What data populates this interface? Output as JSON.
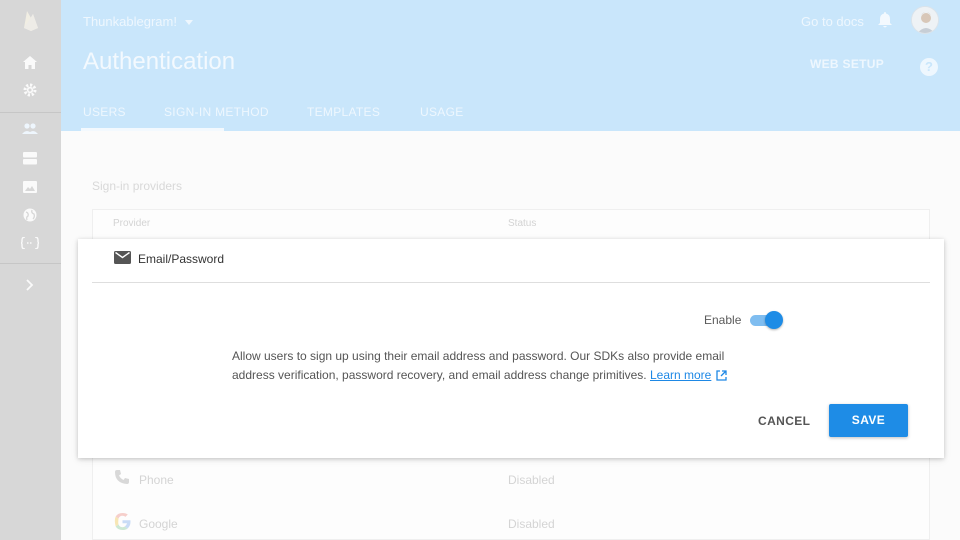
{
  "app": {
    "project_name": "Thunkablegram!",
    "page_title": "Authentication",
    "go_to_docs": "Go to docs",
    "web_setup": "WEB SETUP",
    "help": "?"
  },
  "tabs": [
    {
      "label": "USERS",
      "active": false
    },
    {
      "label": "SIGN-IN METHOD",
      "active": true
    },
    {
      "label": "TEMPLATES",
      "active": false
    },
    {
      "label": "USAGE",
      "active": false
    }
  ],
  "rail_icons": [
    "firebase-logo",
    "home-icon",
    "settings-icon",
    "users-icon",
    "database-icon",
    "storage-icon",
    "hosting-icon",
    "functions-icon",
    "expand-icon"
  ],
  "providers_section": {
    "title": "Sign-in providers",
    "columns": [
      "Provider",
      "Status"
    ],
    "rows": [
      {
        "icon": "phone-icon",
        "name": "Phone",
        "status": "Disabled"
      },
      {
        "icon": "google-icon",
        "name": "Google",
        "status": "Disabled"
      }
    ]
  },
  "modal": {
    "provider_icon": "mail-icon",
    "provider_name": "Email/Password",
    "enable_label": "Enable",
    "enabled": true,
    "description": "Allow users to sign up using their email address and password. Our SDKs also provide email address verification, password recovery, and email address change primitives.",
    "learn_more": "Learn more",
    "cancel": "CANCEL",
    "save": "SAVE"
  },
  "colors": {
    "header_bg": "#c9e6fb",
    "rail_bg": "#d7d7d7",
    "accent": "#1e8ce6",
    "link": "#1e88e5"
  }
}
